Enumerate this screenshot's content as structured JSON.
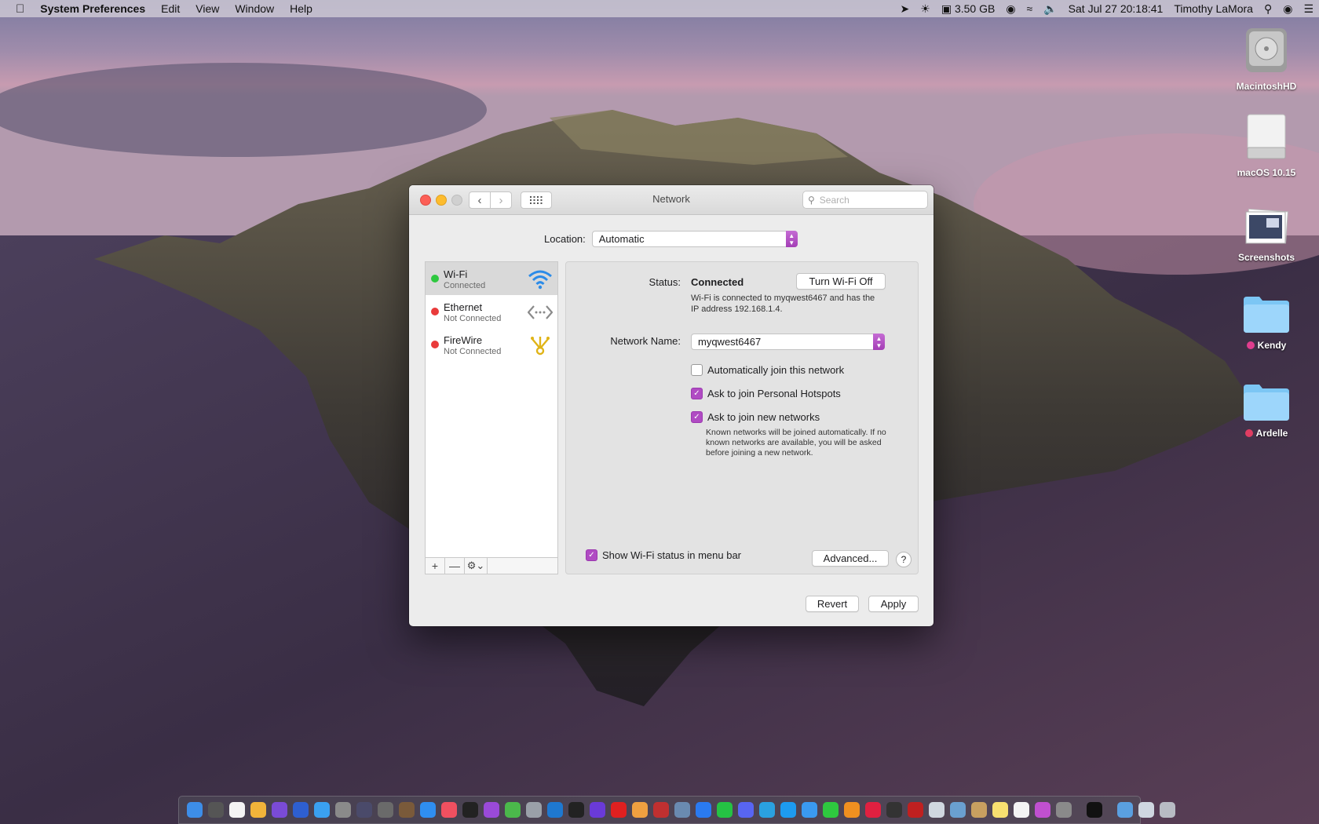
{
  "menubar": {
    "apple_icon": "apple-icon",
    "app_name": "System Preferences",
    "menus": [
      "Edit",
      "View",
      "Window",
      "Help"
    ],
    "status": {
      "memory": "3.50 GB",
      "datetime": "Sat Jul 27  20:18:41",
      "user": "Timothy LaMora"
    }
  },
  "desktop": {
    "icons": [
      {
        "label": "MacintoshHD",
        "icon": "hard-drive-icon"
      },
      {
        "label": "macOS 10.15",
        "icon": "external-drive-icon"
      },
      {
        "label": "Screenshots",
        "icon": "screenshot-stack-icon"
      },
      {
        "label": "Kendy",
        "icon": "folder-icon"
      },
      {
        "label": "Ardelle",
        "icon": "folder-icon"
      }
    ]
  },
  "window": {
    "title": "Network",
    "search_placeholder": "Search",
    "location_label": "Location:",
    "location_value": "Automatic",
    "services": [
      {
        "name": "Wi-Fi",
        "status": "Connected",
        "status_color": "#2ec83f",
        "icon": "wifi-icon",
        "selected": true
      },
      {
        "name": "Ethernet",
        "status": "Not Connected",
        "status_color": "#e93b3b",
        "icon": "ethernet-icon"
      },
      {
        "name": "FireWire",
        "status": "Not Connected",
        "status_color": "#e93b3b",
        "icon": "firewire-icon"
      }
    ],
    "sidebar_buttons": {
      "add": "+",
      "remove": "—",
      "gear": "⚙⌄"
    },
    "detail": {
      "status_label": "Status:",
      "status_value": "Connected",
      "turn_off_button": "Turn Wi-Fi Off",
      "status_note": "Wi-Fi is connected to myqwest6467 and has the IP address 192.168.1.4.",
      "network_name_label": "Network Name:",
      "network_name_value": "myqwest6467",
      "checkboxes": [
        {
          "label": "Automatically join this network",
          "checked": false
        },
        {
          "label": "Ask to join Personal Hotspots",
          "checked": true
        },
        {
          "label": "Ask to join new networks",
          "checked": true
        }
      ],
      "join_note": "Known networks will be joined automatically. If no known networks are available, you will be asked before joining a new network.",
      "show_status_label": "Show Wi-Fi status in menu bar",
      "show_status_checked": true,
      "advanced_button": "Advanced...",
      "help_button": "?"
    },
    "revert_button": "Revert",
    "apply_button": "Apply"
  },
  "colors": {
    "accent": "#b04bc3",
    "connected": "#2ec83f",
    "disconnected": "#e93b3b"
  }
}
